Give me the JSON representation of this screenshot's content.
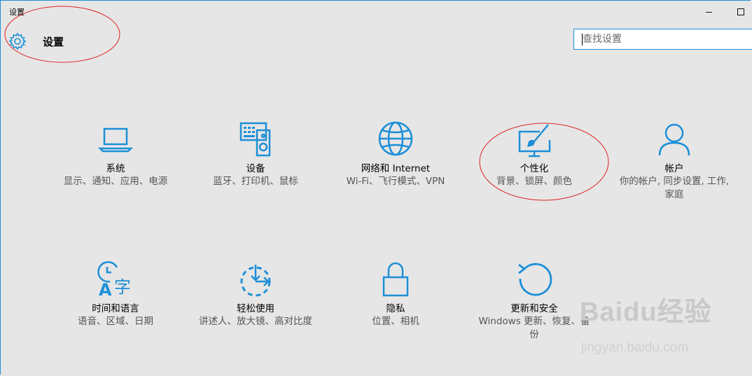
{
  "window": {
    "title": "设置"
  },
  "header": {
    "title": "设置",
    "icon": "gear-icon"
  },
  "search": {
    "placeholder": "查找设置"
  },
  "accent_color": "#1c8fd8",
  "tiles": [
    {
      "name": "系统",
      "desc": "显示、通知、应用、电源",
      "icon": "laptop-icon"
    },
    {
      "name": "设备",
      "desc": "蓝牙、打印机、鼠标",
      "icon": "devices-icon"
    },
    {
      "name": "网络和 Internet",
      "desc": "Wi-Fi、飞行模式、VPN",
      "icon": "globe-icon"
    },
    {
      "name": "个性化",
      "desc": "背景、锁屏、颜色",
      "icon": "personalization-icon"
    },
    {
      "name": "帐户",
      "desc": "你的帐户, 同步设置, 工作, 家庭",
      "icon": "person-icon"
    },
    {
      "name": "时间和语言",
      "desc": "语音、区域、日期",
      "icon": "time-language-icon"
    },
    {
      "name": "轻松使用",
      "desc": "讲述人、放大镜、高对比度",
      "icon": "ease-of-access-icon"
    },
    {
      "name": "隐私",
      "desc": "位置、相机",
      "icon": "lock-icon"
    },
    {
      "name": "更新和安全",
      "desc": "Windows 更新、恢复、备份",
      "icon": "update-icon"
    }
  ],
  "watermark": {
    "logo": "Baidu经验",
    "url": "jingyan.baidu.com"
  }
}
